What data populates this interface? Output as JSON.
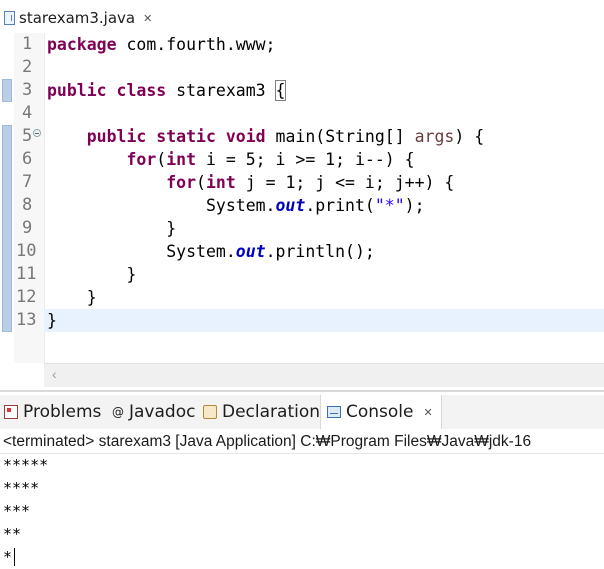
{
  "editor_tab": {
    "filename": "starexam3.java",
    "close": "✕"
  },
  "line_numbers": [
    "1",
    "2",
    "3",
    "4",
    "5",
    "6",
    "7",
    "8",
    "9",
    "10",
    "11",
    "12",
    "13"
  ],
  "code": {
    "l1": {
      "kw": "package",
      "rest": " com.fourth.www;"
    },
    "l3": {
      "kw1": "public",
      "kw2": "class",
      "name": " starexam3 ",
      "brace": "{"
    },
    "l5": {
      "indent": "    ",
      "kw1": "public",
      "kw2": "static",
      "kw3": "void",
      "rest1": " main(String[] ",
      "param": "args",
      "rest2": ") {"
    },
    "l6": {
      "indent": "        ",
      "kw1": "for",
      "p1": "(",
      "kw2": "int",
      "rest": " i = 5; i >= 1; i--) {"
    },
    "l7": {
      "indent": "            ",
      "kw1": "for",
      "p1": "(",
      "kw2": "int",
      "rest": " j = 1; j <= i; j++) {"
    },
    "l8": {
      "indent": "                ",
      "a": "System.",
      "field": "out",
      "b": ".print(",
      "str": "\"*\"",
      "c": ");"
    },
    "l9": {
      "text": "            }"
    },
    "l10": {
      "indent": "            ",
      "a": "System.",
      "field": "out",
      "b": ".println();"
    },
    "l11": {
      "text": "        }"
    },
    "l12": {
      "text": "    }"
    },
    "l13": {
      "text": "}"
    }
  },
  "panel": {
    "tabs": [
      {
        "label": "Problems"
      },
      {
        "label": "Javadoc",
        "prefix": "@"
      },
      {
        "label": "Declaration"
      },
      {
        "label": "Console",
        "close": "✕"
      }
    ],
    "status": "<terminated> starexam3 [Java Application] C:₩Program Files₩Java₩jdk-16",
    "output": [
      "*****",
      "****",
      "***",
      "**",
      "*"
    ]
  },
  "colors": {
    "keyword": "#7f0055",
    "field": "#0000c0",
    "string": "#2a00ff",
    "current_line": "#e8f2fe"
  }
}
